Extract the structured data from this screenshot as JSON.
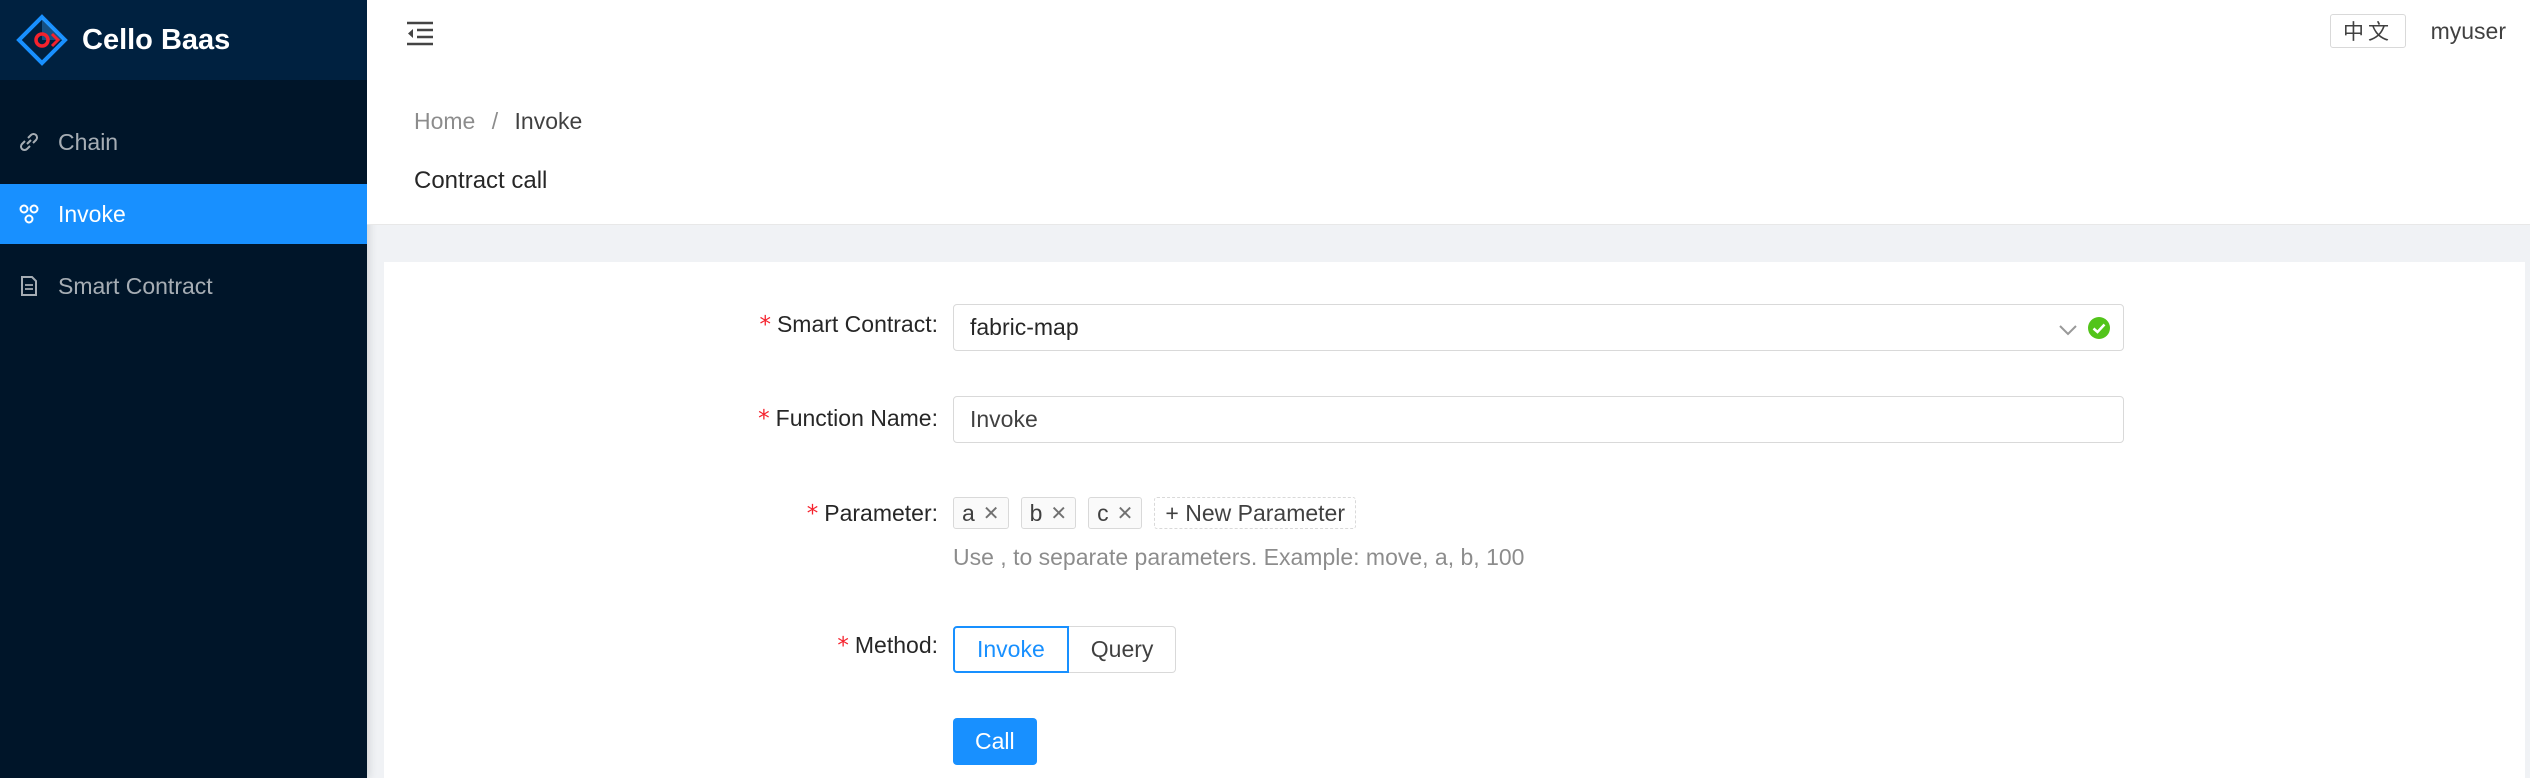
{
  "app": {
    "title": "Cello Baas"
  },
  "sidebar": {
    "items": [
      {
        "label": "Chain",
        "icon": "link-icon",
        "active": false
      },
      {
        "label": "Invoke",
        "icon": "cluster-icon",
        "active": true
      },
      {
        "label": "Smart Contract",
        "icon": "file-text-icon",
        "active": false
      }
    ]
  },
  "header": {
    "language": "中文",
    "username": "myuser"
  },
  "breadcrumb": {
    "home": "Home",
    "separator": "/",
    "current": "Invoke"
  },
  "page": {
    "title": "Contract call"
  },
  "form": {
    "smart_contract": {
      "label": "Smart Contract",
      "value": "fabric-map"
    },
    "function_name": {
      "label": "Function Name",
      "value": "Invoke"
    },
    "parameter": {
      "label": "Parameter",
      "tags": [
        "a",
        "b",
        "c"
      ],
      "new_label": "+ New Parameter",
      "help": "Use , to separate parameters. Example: move, a, b, 100"
    },
    "method": {
      "label": "Method",
      "options": [
        "Invoke",
        "Query"
      ],
      "selected": "Invoke"
    },
    "submit_label": "Call",
    "required_mark": "*",
    "colon": ":"
  },
  "colors": {
    "primary": "#1890ff",
    "sider": "#001529",
    "required": "#f5222d",
    "success": "#52c41a"
  }
}
